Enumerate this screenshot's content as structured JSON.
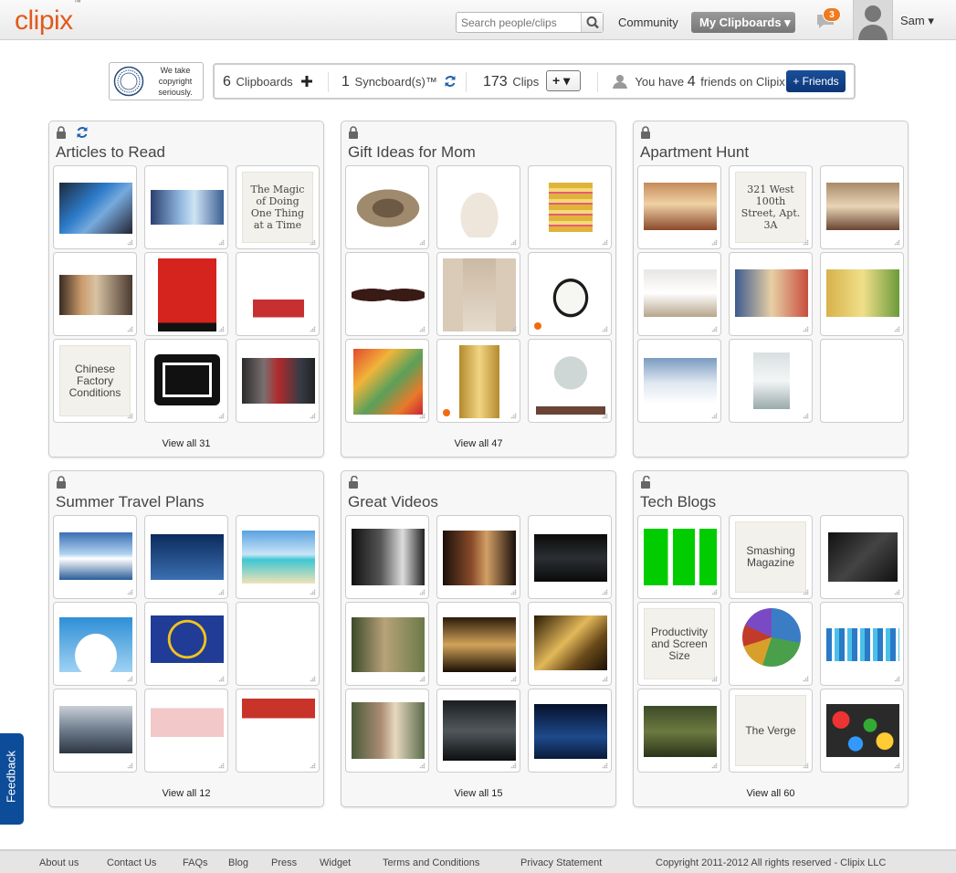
{
  "header": {
    "logo": "clipix",
    "logo_tm": "™",
    "search_placeholder": "Search people/clips",
    "community": "Community",
    "my_clipboards": "My Clipboards ▾",
    "notification_count": "3",
    "user": "Sam ▾"
  },
  "copyright_badge": {
    "text": "We take copyright seriously."
  },
  "stats": {
    "clipboards_count": "6",
    "clipboards_label": "Clipboards",
    "syncboards_count": "1",
    "syncboards_label": "Syncboard(s)™",
    "clips_count": "173",
    "clips_label": "Clips",
    "add_clip": "+ ▾",
    "friends_prefix": "You have",
    "friends_count": "4",
    "friends_suffix": "friends on Clipix",
    "add_friends": "+ Friends"
  },
  "boards": [
    {
      "title": "Articles to Read",
      "view_all": "View all 31",
      "locked": true,
      "synced": true,
      "tiles": [
        {
          "kind": "image",
          "icon": "tablet-photo"
        },
        {
          "kind": "image",
          "icon": "tweet-chill-photo"
        },
        {
          "kind": "text",
          "text": "The Magic of Doing One Thing at a Time",
          "serif": true
        },
        {
          "kind": "image",
          "icon": "presentation-photo"
        },
        {
          "kind": "image",
          "icon": "daily-beast-logo"
        },
        {
          "kind": "image",
          "icon": "illustration-boy"
        },
        {
          "kind": "text",
          "text": "Chinese Factory Conditions"
        },
        {
          "kind": "image",
          "icon": "ipad-frame"
        },
        {
          "kind": "image",
          "icon": "crowd-photo"
        }
      ]
    },
    {
      "title": "Gift Ideas for Mom",
      "view_all": "View all 47",
      "locked": true,
      "synced": false,
      "tiles": [
        {
          "kind": "image",
          "icon": "sun-hat"
        },
        {
          "kind": "image",
          "icon": "white-handbag"
        },
        {
          "kind": "image",
          "icon": "gold-rings"
        },
        {
          "kind": "image",
          "icon": "sunglasses"
        },
        {
          "kind": "image",
          "icon": "black-dress"
        },
        {
          "kind": "image",
          "icon": "white-heel",
          "dot": true
        },
        {
          "kind": "image",
          "icon": "floral-phone-cases"
        },
        {
          "kind": "image",
          "icon": "gold-watch",
          "dot": true
        },
        {
          "kind": "image",
          "icon": "jewelry-tree"
        }
      ]
    },
    {
      "title": "Apartment Hunt",
      "view_all": "",
      "locked": true,
      "synced": false,
      "tiles": [
        {
          "kind": "image",
          "icon": "living-room"
        },
        {
          "kind": "text",
          "text": "321 West 100th Street, Apt. 3A",
          "serif": true
        },
        {
          "kind": "image",
          "icon": "dining-room"
        },
        {
          "kind": "image",
          "icon": "kitchen"
        },
        {
          "kind": "image",
          "icon": "blue-room"
        },
        {
          "kind": "image",
          "icon": "yellow-room"
        },
        {
          "kind": "image",
          "icon": "bedroom"
        },
        {
          "kind": "image",
          "icon": "bathroom"
        },
        {
          "kind": "empty"
        }
      ]
    },
    {
      "title": "Summer Travel Plans",
      "view_all": "View all 12",
      "locked": true,
      "synced": false,
      "tiles": [
        {
          "kind": "image",
          "icon": "cruise-ship"
        },
        {
          "kind": "image",
          "icon": "private-jet"
        },
        {
          "kind": "image",
          "icon": "beach"
        },
        {
          "kind": "image",
          "icon": "wifi-cloud"
        },
        {
          "kind": "image",
          "icon": "eu-flag"
        },
        {
          "kind": "image",
          "icon": "airline-logos"
        },
        {
          "kind": "image",
          "icon": "airport"
        },
        {
          "kind": "image",
          "icon": "price-chart"
        },
        {
          "kind": "image",
          "icon": "calendar"
        }
      ]
    },
    {
      "title": "Great Videos",
      "view_all": "View all 15",
      "locked": false,
      "synced": false,
      "tiles": [
        {
          "kind": "image",
          "icon": "video-singer"
        },
        {
          "kind": "image",
          "icon": "video-violin"
        },
        {
          "kind": "image",
          "icon": "video-dark"
        },
        {
          "kind": "image",
          "icon": "video-forest"
        },
        {
          "kind": "image",
          "icon": "video-first-aid-kit"
        },
        {
          "kind": "image",
          "icon": "video-golden"
        },
        {
          "kind": "image",
          "icon": "video-sisters"
        },
        {
          "kind": "image",
          "icon": "video-studio"
        },
        {
          "kind": "image",
          "icon": "video-night-sky"
        }
      ]
    },
    {
      "title": "Tech Blogs",
      "view_all": "View all 60",
      "locked": false,
      "synced": false,
      "tiles": [
        {
          "kind": "image",
          "icon": "techcrunch-logo"
        },
        {
          "kind": "text",
          "text": "Smashing Magazine"
        },
        {
          "kind": "image",
          "icon": "ipad-apps"
        },
        {
          "kind": "text",
          "text": "Productivity and Screen Size"
        },
        {
          "kind": "image",
          "icon": "pie-chart"
        },
        {
          "kind": "image",
          "icon": "blue-pixels"
        },
        {
          "kind": "image",
          "icon": "the-myth-cover"
        },
        {
          "kind": "text",
          "text": "The Verge"
        },
        {
          "kind": "image",
          "icon": "colorful-keys"
        }
      ]
    }
  ],
  "feedback": "Feedback",
  "footer": {
    "links": [
      "About us",
      "Contact Us",
      "FAQs",
      "Blog",
      "Press",
      "Widget",
      "Terms and Conditions",
      "Privacy Statement"
    ],
    "copyright": "Copyright 2011-2012 All rights reserved - Clipix LLC"
  }
}
